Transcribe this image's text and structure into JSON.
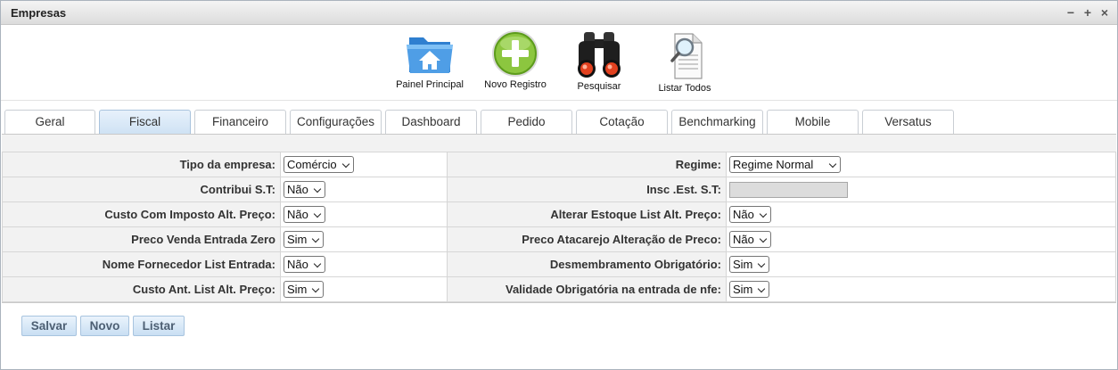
{
  "window": {
    "title": "Empresas"
  },
  "toolbar": {
    "items": [
      {
        "label": "Painel Principal",
        "icon": "folder-home-icon"
      },
      {
        "label": "Novo Registro",
        "icon": "add-circle-icon"
      },
      {
        "label": "Pesquisar",
        "icon": "binoculars-icon"
      },
      {
        "label": "Listar Todos",
        "icon": "document-search-icon"
      }
    ]
  },
  "tabs": [
    "Geral",
    "Fiscal",
    "Financeiro",
    "Configurações",
    "Dashboard",
    "Pedido",
    "Cotação",
    "Benchmarking",
    "Mobile",
    "Versatus"
  ],
  "active_tab": "Fiscal",
  "form": {
    "left": [
      {
        "label": "Tipo da empresa:",
        "value": "Comércio"
      },
      {
        "label": "Contribui S.T:",
        "value": "Não"
      },
      {
        "label": "Custo Com Imposto Alt. Preço:",
        "value": "Não"
      },
      {
        "label": "Preco Venda Entrada Zero",
        "value": "Sim"
      },
      {
        "label": "Nome Fornecedor List Entrada:",
        "value": "Não"
      },
      {
        "label": "Custo Ant. List Alt. Preço:",
        "value": "Sim"
      }
    ],
    "right": [
      {
        "label": "Regime:",
        "value": "Regime Normal"
      },
      {
        "label": "Insc .Est. S.T:",
        "value": ""
      },
      {
        "label": "Alterar Estoque List Alt. Preço:",
        "value": "Não"
      },
      {
        "label": "Preco Atacarejo Alteração de Preco:",
        "value": "Não"
      },
      {
        "label": "Desmembramento Obrigatório:",
        "value": "Sim"
      },
      {
        "label": "Validade Obrigatória na entrada de nfe:",
        "value": "Sim"
      }
    ]
  },
  "buttons": {
    "save": "Salvar",
    "new": "Novo",
    "list": "Listar"
  }
}
